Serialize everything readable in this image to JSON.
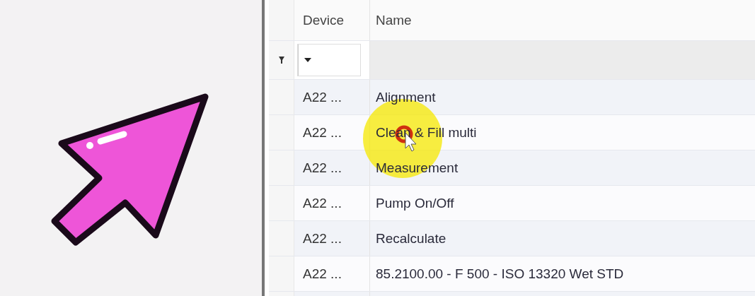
{
  "table": {
    "columns": [
      "Device",
      "Name"
    ],
    "filter_row": {
      "device_filter": {
        "kind": "dropdown"
      }
    },
    "rows": [
      {
        "device": "A22 ...",
        "name": "Alignment"
      },
      {
        "device": "A22 ...",
        "name": "Clean & Fill multi"
      },
      {
        "device": "A22 ...",
        "name": "Measurement"
      },
      {
        "device": "A22 ...",
        "name": "Pump On/Off"
      },
      {
        "device": "A22 ...",
        "name": "Recalculate"
      },
      {
        "device": "A22 ...",
        "name": "85.2100.00 - F 500 - ISO 13320 Wet STD"
      }
    ]
  }
}
